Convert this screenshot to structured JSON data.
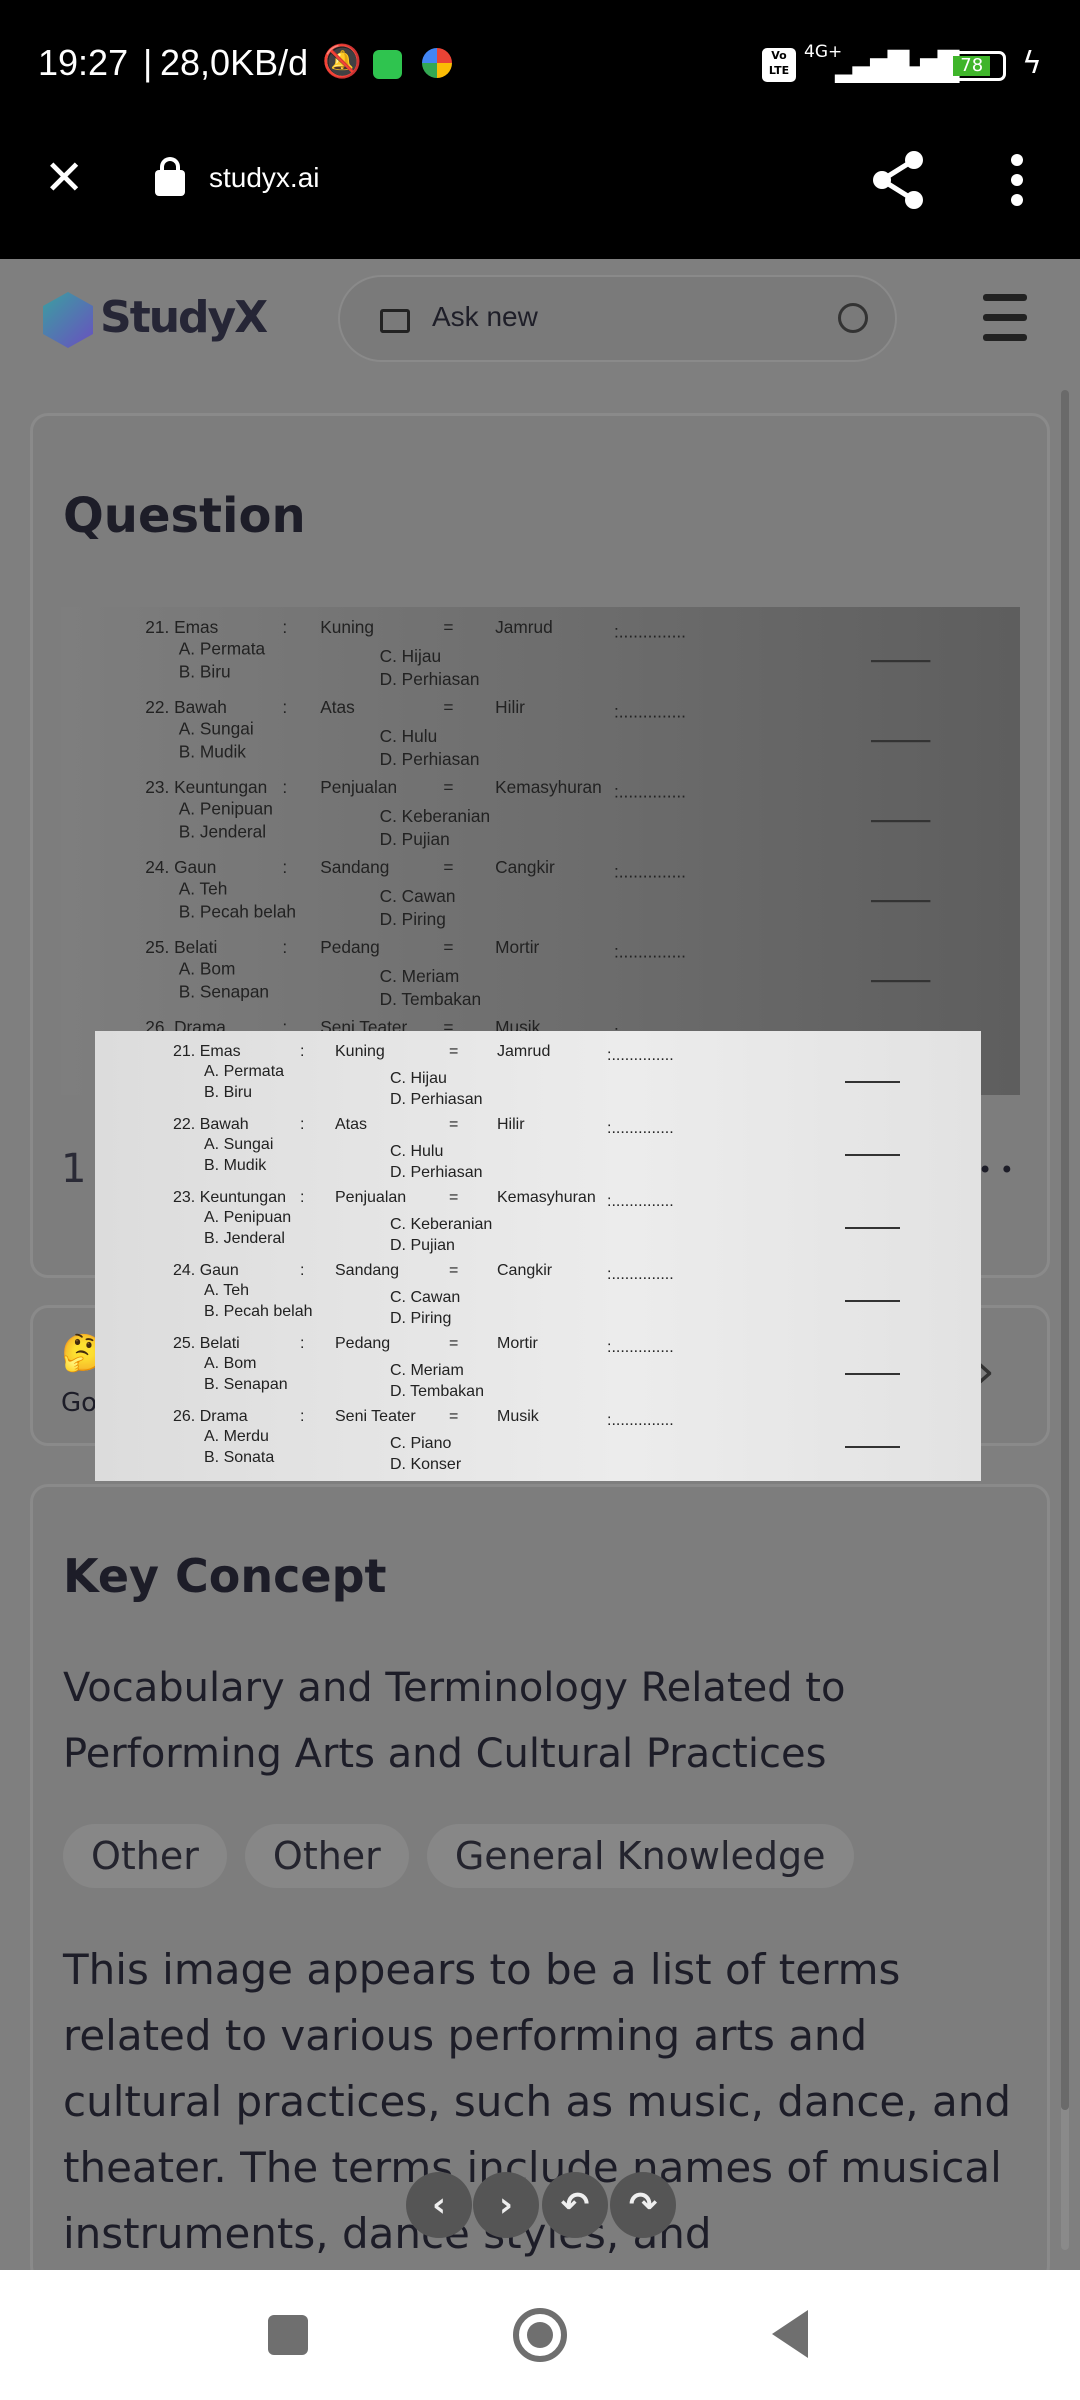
{
  "status_bar": {
    "time": "19:27",
    "speed": "28,0KB/d",
    "network": "4G+",
    "volte": "Vo LTE",
    "battery": "78",
    "icons": [
      "bell-off-icon",
      "whatsapp-icon",
      "pinwheel-icon",
      "signal-icon",
      "battery-icon",
      "charging-icon"
    ]
  },
  "browser": {
    "url": "studyx.ai",
    "icons": [
      "close-icon",
      "lock-icon",
      "share-icon",
      "more-icon"
    ]
  },
  "header": {
    "logo": "StudyX",
    "search_placeholder": "Ask new"
  },
  "question_card": {
    "title": "Question",
    "footer_text": "1 c",
    "dots": "• •"
  },
  "hint_card": {
    "emoji": "🤔",
    "text": "Go"
  },
  "worksheet": {
    "items": [
      {
        "num": "21. Emas",
        "sep": ":",
        "w2": "Kuning",
        "eq": "=",
        "w3": "Jamrud",
        "dots": ":..............",
        "a": "A. Permata",
        "b": "B. Biru",
        "c": "C. Hijau",
        "d": "D. Perhiasan"
      },
      {
        "num": "22. Bawah",
        "sep": ":",
        "w2": "Atas",
        "eq": "=",
        "w3": "Hilir",
        "dots": ":..............",
        "a": "A. Sungai",
        "b": "B. Mudik",
        "c": "C. Hulu",
        "d": "D. Perhiasan"
      },
      {
        "num": "23. Keuntungan",
        "sep": ":",
        "w2": "Penjualan",
        "eq": "=",
        "w3": "Kemasyhuran",
        "dots": ":..............",
        "a": "A. Penipuan",
        "b": "B. Jenderal",
        "c": "C. Keberanian",
        "d": "D. Pujian"
      },
      {
        "num": "24. Gaun",
        "sep": ":",
        "w2": "Sandang",
        "eq": "=",
        "w3": "Cangkir",
        "dots": ":..............",
        "a": "A. Teh",
        "b": "B. Pecah belah",
        "c": "C. Cawan",
        "d": "D. Piring"
      },
      {
        "num": "25. Belati",
        "sep": ":",
        "w2": "Pedang",
        "eq": "=",
        "w3": "Mortir",
        "dots": ":..............",
        "a": "A. Bom",
        "b": "B. Senapan",
        "c": "C. Meriam",
        "d": "D. Tembakan"
      },
      {
        "num": "26. Drama",
        "sep": ":",
        "w2": "Seni Teater",
        "eq": "=",
        "w3": "Musik",
        "dots": ":..............",
        "a": "A. Merdu",
        "b": "B. Sonata",
        "c": "C. Piano",
        "d": "D. Konser"
      }
    ]
  },
  "key_concept": {
    "title": "Key Concept",
    "subtitle": "Vocabulary and Terminology Related to Performing Arts and Cultural Practices",
    "tags": [
      "Other",
      "Other",
      "General Knowledge"
    ],
    "body": "This image appears to be a list of terms related to various performing arts and cultural practices, such as music, dance, and theater. The terms include names of musical instruments, dance styles, and"
  },
  "float_buttons": [
    "‹",
    "›",
    "↶",
    "↷"
  ],
  "nav": [
    "recents-icon",
    "home-icon",
    "back-icon"
  ]
}
